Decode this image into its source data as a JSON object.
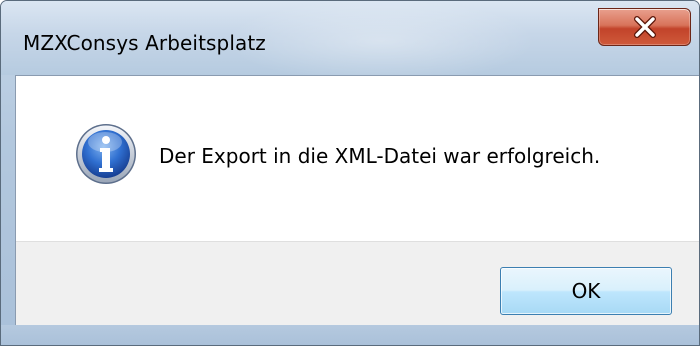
{
  "window": {
    "title": "MZXConsys Arbeitsplatz",
    "close_icon": "close-icon"
  },
  "dialog": {
    "icon": "info-icon",
    "message": "Der Export in die XML-Datei war erfolgreich."
  },
  "buttons": {
    "ok_label": "OK"
  },
  "colors": {
    "close_button": "#c2432a",
    "ok_button_border": "#3c7fb1",
    "footer_bg": "#f0f0f0"
  }
}
